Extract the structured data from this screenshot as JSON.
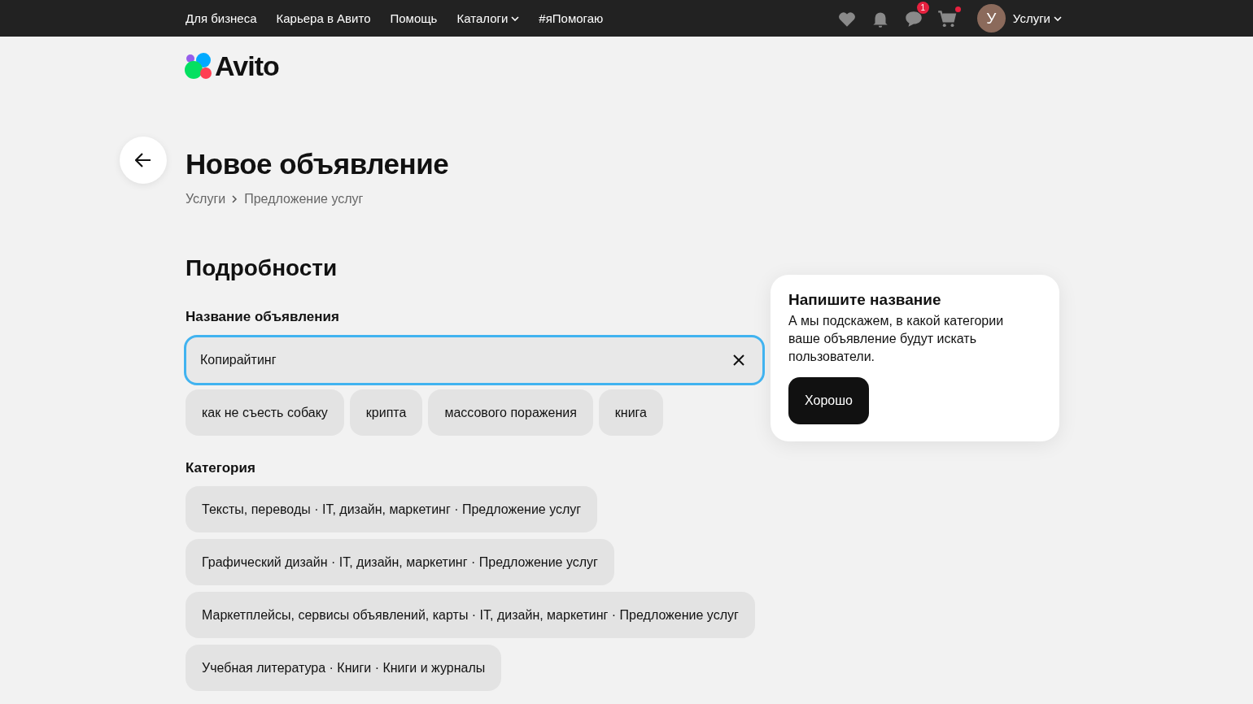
{
  "topbar": {
    "links": [
      {
        "label": "Для бизнеса",
        "kind": "link"
      },
      {
        "label": "Карьера в Авито",
        "kind": "link"
      },
      {
        "label": "Помощь",
        "kind": "link"
      },
      {
        "label": "Каталоги",
        "kind": "dropdown"
      },
      {
        "label": "#яПомогаю",
        "kind": "link"
      }
    ],
    "messages_badge": "1",
    "avatar_letter": "У",
    "user_menu": "Услуги"
  },
  "logo": {
    "text": "Avito"
  },
  "title": "Новое объявление",
  "breadcrumbs": [
    "Услуги",
    "Предложение услуг"
  ],
  "section_title": "Подробности",
  "name_field": {
    "label": "Название объявления",
    "value": "Копирайтинг"
  },
  "suggestions": [
    "как не съесть собаку",
    "крипта",
    "массового поражения",
    "книга"
  ],
  "category": {
    "label": "Категория",
    "options": [
      "Тексты, переводы · IT, дизайн, маркетинг · Предложение услуг",
      "Графический дизайн · IT, дизайн, маркетинг · Предложение услуг",
      "Маркетплейсы, сервисы объявлений, карты · IT, дизайн, маркетинг · Предложение услуг",
      "Учебная литература · Книги · Книги и журналы"
    ]
  },
  "hint": {
    "title": "Напишите название",
    "text": "А мы подскажем, в какой категории ваше объявление будут искать пользователи.",
    "button": "Хорошо"
  }
}
